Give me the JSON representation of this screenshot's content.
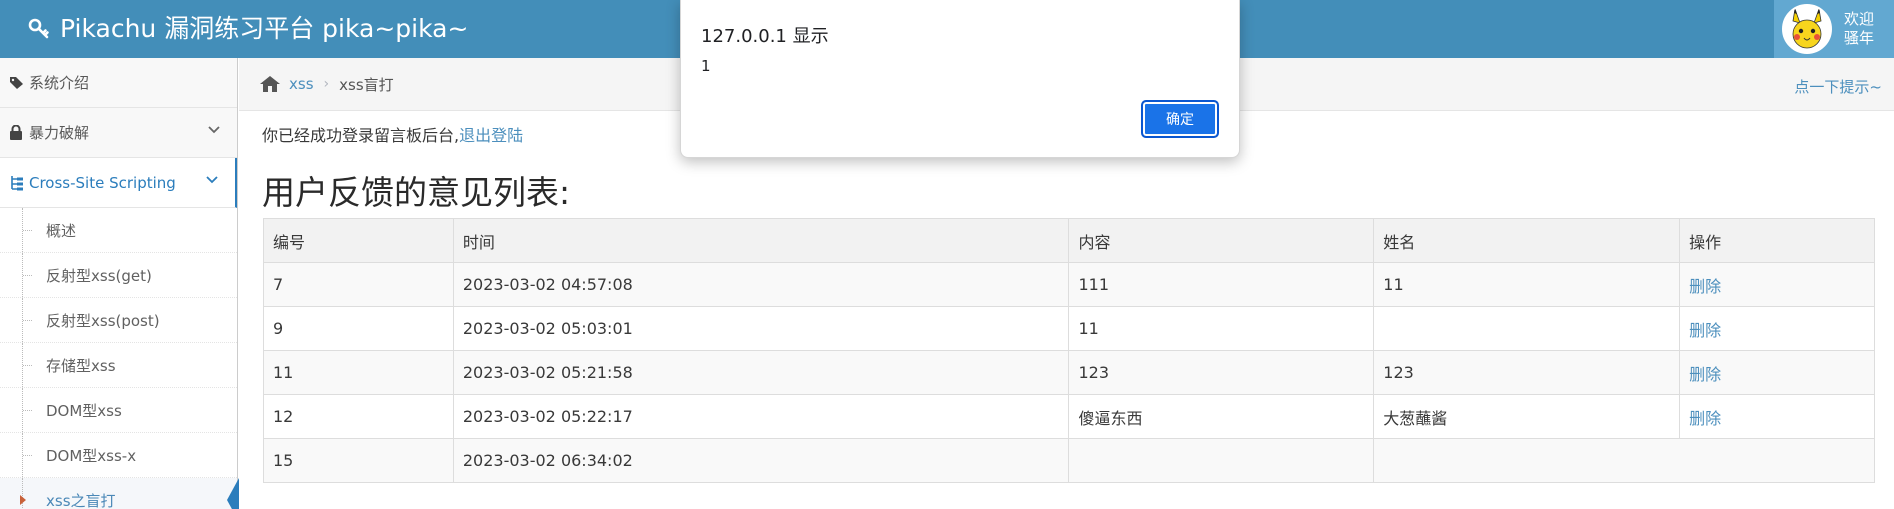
{
  "app": {
    "brand": "Pikachu 漏洞练习平台 pika~pika~",
    "user_greeting_line1": "欢迎",
    "user_greeting_line2": "骚年"
  },
  "sidebar": {
    "items": [
      {
        "label": "系统介绍",
        "icon": "tags-icon"
      },
      {
        "label": "暴力破解",
        "icon": "lock-icon"
      },
      {
        "label": "Cross-Site Scripting",
        "icon": "sitemap-icon"
      }
    ],
    "submenu": [
      {
        "label": "概述"
      },
      {
        "label": "反射型xss(get)"
      },
      {
        "label": "反射型xss(post)"
      },
      {
        "label": "存储型xss"
      },
      {
        "label": "DOM型xss"
      },
      {
        "label": "DOM型xss-x"
      },
      {
        "label": "xss之盲打"
      }
    ]
  },
  "breadcrumb": {
    "root": "xss",
    "current": "xss盲打",
    "hint": "点一下提示~"
  },
  "content": {
    "login_text": "你已经成功登录留言板后台,",
    "logout_link": "退出登陆",
    "title": "用户反馈的意见列表:"
  },
  "table": {
    "headers": [
      "编号",
      "时间",
      "内容",
      "姓名",
      "操作"
    ],
    "rows": [
      {
        "id": "7",
        "time": "2023-03-02 04:57:08",
        "content": "111",
        "name": "11",
        "action": "删除"
      },
      {
        "id": "9",
        "time": "2023-03-02 05:03:01",
        "content": "11",
        "name": "",
        "action": "删除"
      },
      {
        "id": "11",
        "time": "2023-03-02 05:21:58",
        "content": "123",
        "name": "123",
        "action": "删除"
      },
      {
        "id": "12",
        "time": "2023-03-02 05:22:17",
        "content": "傻逼东西",
        "name": "大葱蘸酱",
        "action": "删除"
      },
      {
        "id": "15",
        "time": "2023-03-02 06:34:02",
        "content": "",
        "name": "",
        "action": ""
      }
    ]
  },
  "dialog": {
    "title": "127.0.0.1 显示",
    "message": "1",
    "ok_label": "确定"
  },
  "colors": {
    "navbar": "#438eb9",
    "accent": "#2b7dbc",
    "link": "#4c8fbd",
    "dialog_button": "#1a73e8"
  }
}
